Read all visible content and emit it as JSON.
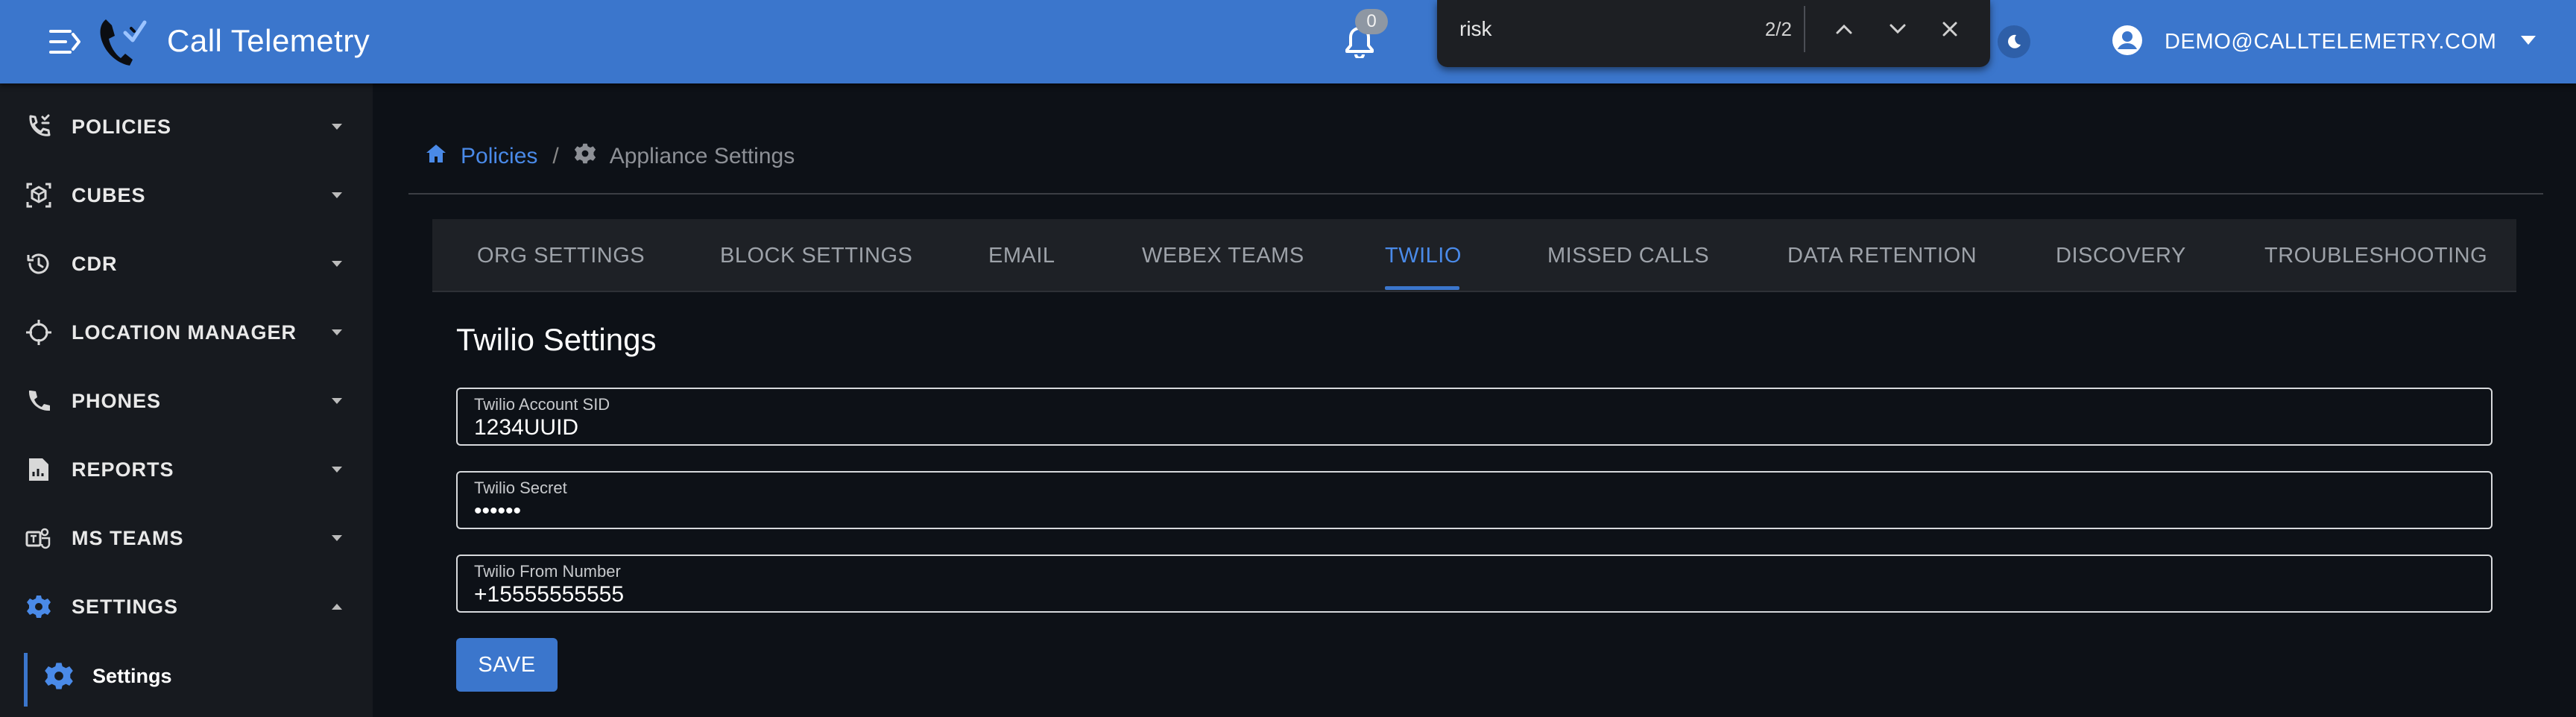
{
  "header": {
    "app_title": "Call Telemetry",
    "notification_count": "0",
    "account_name": "DEMO@CALLTELEMETRY.COM",
    "icons": {
      "menu": "menu-collapse-icon",
      "logo": "phone-logo-icon",
      "notifications": "bell-icon",
      "theme": "moon-icon",
      "account": "account-circle-icon",
      "account_menu": "caret-down-icon"
    }
  },
  "find_bar": {
    "query": "risk",
    "match_count": "2/2",
    "icons": {
      "previous": "chevron-up-icon",
      "next": "chevron-down-icon",
      "close": "close-icon"
    }
  },
  "sidebar": {
    "items": [
      {
        "label": "POLICIES",
        "icon": "phone-policy-icon",
        "expanded": false
      },
      {
        "label": "CUBES",
        "icon": "cube-icon",
        "expanded": false
      },
      {
        "label": "CDR",
        "icon": "history-icon",
        "expanded": false
      },
      {
        "label": "LOCATION MANAGER",
        "icon": "crosshair-icon",
        "expanded": false
      },
      {
        "label": "PHONES",
        "icon": "phone-icon",
        "expanded": false
      },
      {
        "label": "REPORTS",
        "icon": "report-icon",
        "expanded": false
      },
      {
        "label": "MS TEAMS",
        "icon": "teams-icon",
        "expanded": false
      },
      {
        "label": "SETTINGS",
        "icon": "gear-icon",
        "expanded": true
      }
    ],
    "sub_items": [
      {
        "label": "Settings",
        "icon": "gear-icon",
        "active": true
      }
    ]
  },
  "breadcrumb": {
    "home": "Policies",
    "separator": "/",
    "current": "Appliance Settings"
  },
  "tabs": [
    {
      "label": "ORG SETTINGS",
      "active": false
    },
    {
      "label": "BLOCK SETTINGS",
      "active": false
    },
    {
      "label": "EMAIL",
      "active": false
    },
    {
      "label": "WEBEX TEAMS",
      "active": false
    },
    {
      "label": "TWILIO",
      "active": true
    },
    {
      "label": "MISSED CALLS",
      "active": false
    },
    {
      "label": "DATA RETENTION",
      "active": false
    },
    {
      "label": "DISCOVERY",
      "active": false
    },
    {
      "label": "TROUBLESHOOTING",
      "active": false
    }
  ],
  "twilio": {
    "title": "Twilio Settings",
    "fields": [
      {
        "label": "Twilio Account SID",
        "value": "1234UUID",
        "type": "text"
      },
      {
        "label": "Twilio Secret",
        "value": "••••••",
        "type": "password"
      },
      {
        "label": "Twilio From Number",
        "value": "+15555555555",
        "type": "text"
      }
    ],
    "save_label": "SAVE"
  },
  "colors": {
    "brand": "#3b76cc",
    "link": "#4a8ae8",
    "background": "#0d1117",
    "sidebar": "#171a1f"
  }
}
